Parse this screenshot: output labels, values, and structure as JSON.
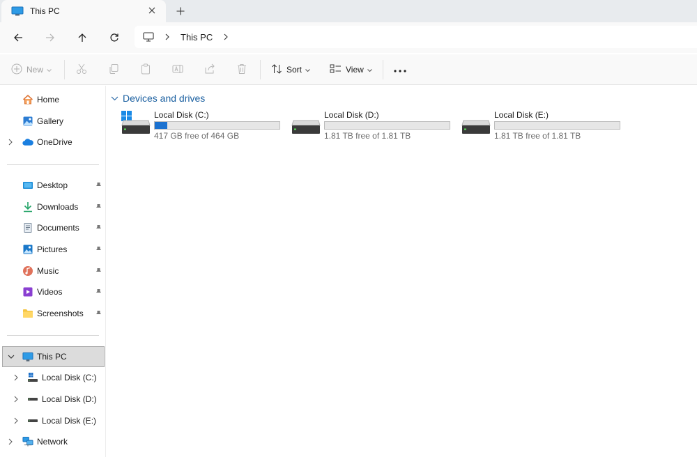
{
  "tab": {
    "title": "This PC"
  },
  "address": {
    "crumbs": [
      "This PC"
    ]
  },
  "commands": {
    "new": "New",
    "sort": "Sort",
    "view": "View"
  },
  "sidebar": {
    "top": [
      {
        "label": "Home",
        "icon": "home-icon"
      },
      {
        "label": "Gallery",
        "icon": "gallery-icon"
      },
      {
        "label": "OneDrive",
        "icon": "onedrive-icon"
      }
    ],
    "pinned": [
      {
        "label": "Desktop",
        "icon": "desktop-folder-icon"
      },
      {
        "label": "Downloads",
        "icon": "downloads-folder-icon"
      },
      {
        "label": "Documents",
        "icon": "documents-folder-icon"
      },
      {
        "label": "Pictures",
        "icon": "pictures-folder-icon"
      },
      {
        "label": "Music",
        "icon": "music-folder-icon"
      },
      {
        "label": "Videos",
        "icon": "videos-folder-icon"
      },
      {
        "label": "Screenshots",
        "icon": "folder-icon"
      }
    ],
    "this_pc": {
      "label": "This PC",
      "icon": "computer-icon"
    },
    "drives": [
      {
        "label": "Local Disk (C:)"
      },
      {
        "label": "Local Disk (D:)"
      },
      {
        "label": "Local Disk (E:)"
      }
    ],
    "network": {
      "label": "Network"
    }
  },
  "main": {
    "group_title": "Devices and drives",
    "drives": [
      {
        "name": "Local Disk (C:)",
        "free_text": "417 GB free of 464 GB",
        "used_fraction": 0.1,
        "system": true
      },
      {
        "name": "Local Disk (D:)",
        "free_text": "1.81 TB free of 1.81 TB",
        "used_fraction": 0.0,
        "system": false
      },
      {
        "name": "Local Disk (E:)",
        "free_text": "1.81 TB free of 1.81 TB",
        "used_fraction": 0.0,
        "system": false
      }
    ]
  },
  "colors": {
    "accent": "#1c72d0",
    "group_title": "#1a5fa0",
    "selected_bg": "#dcdcdc"
  }
}
